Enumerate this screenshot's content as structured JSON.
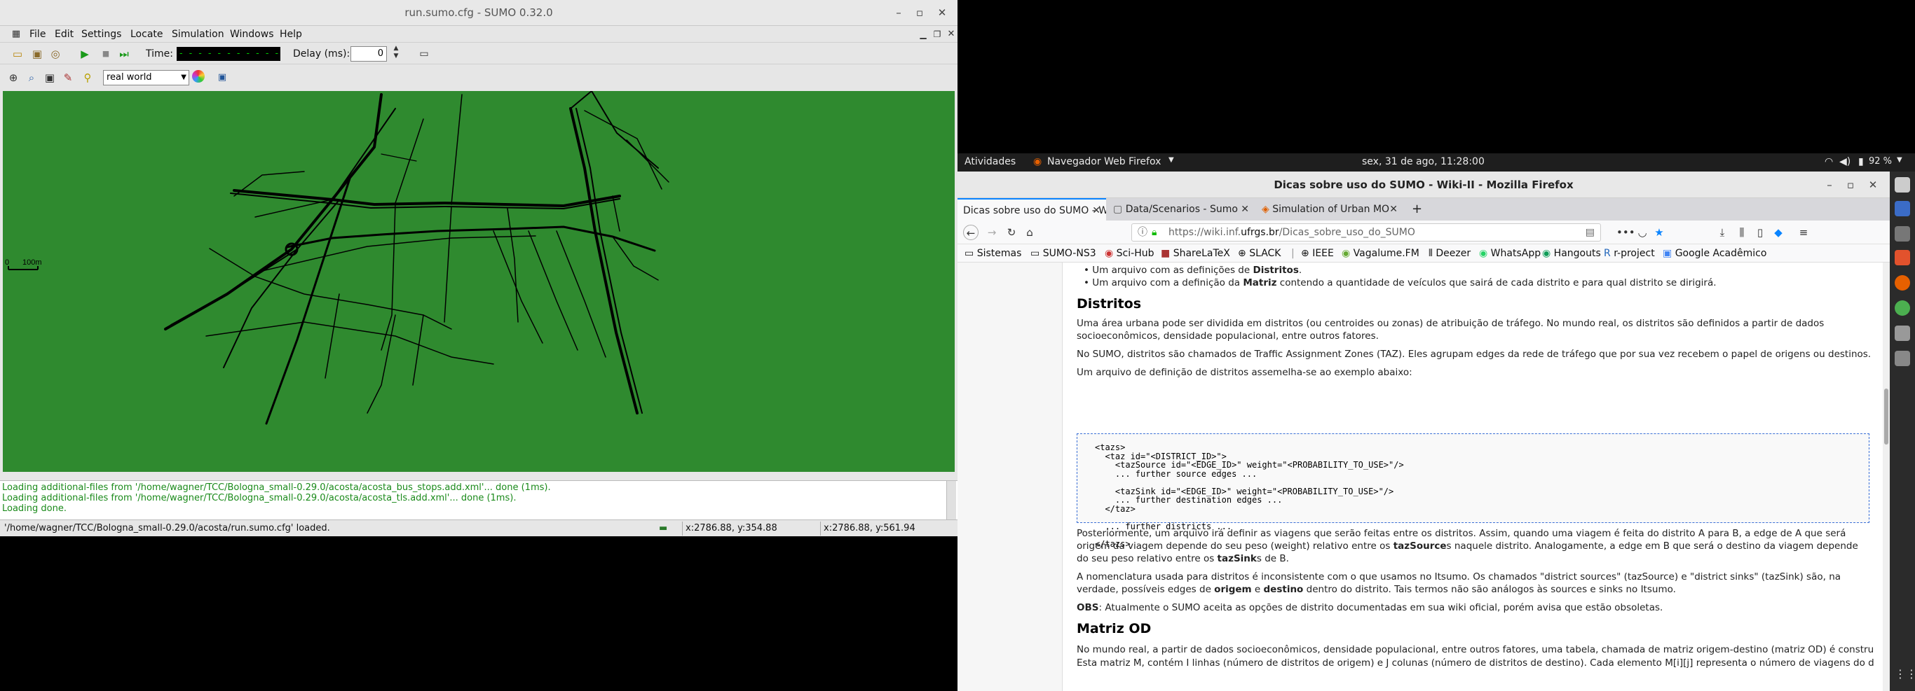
{
  "sumo": {
    "title": "run.sumo.cfg - SUMO 0.32.0",
    "menu": [
      "File",
      "Edit",
      "Settings",
      "Locate",
      "Simulation",
      "Windows",
      "Help"
    ],
    "time_label": "Time:",
    "time_value": "- - - - - - - - - - - - -",
    "delay_label": "Delay (ms):",
    "delay_value": "0",
    "scheme": "real world",
    "scale_zero": "0",
    "scale_label": "100m",
    "log": [
      "Loading additional-files from '/home/wagner/TCC/Bologna_small-0.29.0/acosta/acosta_bus_stops.add.xml'... done (1ms).",
      "Loading additional-files from '/home/wagner/TCC/Bologna_small-0.29.0/acosta/acosta_tls.add.xml'... done (1ms).",
      "Loading done."
    ],
    "status": "'/home/wagner/TCC/Bologna_small-0.29.0/acosta/run.sumo.cfg' loaded.",
    "coord1": "x:2786.88, y:354.88",
    "coord2": "x:2786.88, y:561.94"
  },
  "gnome": {
    "activities": "Atividades",
    "app": "Navegador Web Firefox",
    "clock": "sex, 31 de ago, 11:28:00",
    "battery": "92 %"
  },
  "firefox": {
    "title": "Dicas sobre uso do SUMO - Wiki-II - Mozilla Firefox",
    "tabs": [
      {
        "label": "Dicas sobre uso do SUMO - W"
      },
      {
        "label": "Data/Scenarios - Sumo"
      },
      {
        "label": "Simulation of Urban MO"
      }
    ],
    "url_host": "https://wiki.inf.",
    "url_domain": "ufrgs.br",
    "url_path": "/Dicas_sobre_uso_do_SUMO",
    "bookmarks": [
      "Sistemas",
      "SUMO-NS3",
      "Sci-Hub",
      "ShareLaTeX",
      "SLACK",
      "IEEE",
      "Vagalume.FM",
      "Deezer",
      "WhatsApp",
      "Hangouts",
      "r-project",
      "Google Acadêmico"
    ]
  },
  "wiki": {
    "bullet1_pre": "Um arquivo com as definições de ",
    "bullet1_bold": "Distritos",
    "bullet1_post": ".",
    "bullet2_pre": "Um arquivo com a definição da ",
    "bullet2_bold": "Matriz",
    "bullet2_post": " contendo a quantidade de veículos que sairá de cada distrito e para qual distrito se dirigirá.",
    "h_distritos": "Distritos",
    "p1": "Uma área urbana pode ser dividida em distritos (ou centroides ou zonas) de atribuição de tráfego. No mundo real, os distritos são definidos a partir de dados socioeconômicos, densidade populacional, entre outros fatores.",
    "p2": "No SUMO, distritos são chamados de Traffic Assignment Zones (TAZ). Eles agrupam edges da rede de tráfego que por sua vez recebem o papel de origens ou destinos.",
    "p3": "Um arquivo de definição de distritos assemelha-se ao exemplo abaixo:",
    "code": "<tazs>\n  <taz id=\"<DISTRICT_ID>\">\n    <tazSource id=\"<EDGE_ID>\" weight=\"<PROBABILITY_TO_USE>\"/>\n    ... further source edges ...\n\n    <tazSink id=\"<EDGE_ID>\" weight=\"<PROBABILITY_TO_USE>\"/>\n    ... further destination edges ...\n  </taz>\n\n  ... further districts ...\n\n</tazs>",
    "p4_a": "Posteriormente, um arquivo irá definir as viagens que serão feitas entre os distritos. Assim, quando uma viagem é feita do distrito A para B, a edge de A que será origem da viagem depende do seu peso (weight) relativo entre os ",
    "p4_b": "tazSource",
    "p4_c": "s naquele distrito. Analogamente, a edge em B que será o destino da viagem depende do seu peso relativo entre os ",
    "p4_d": "tazSink",
    "p4_e": "s de B.",
    "p5_a": "A nomenclatura usada para distritos é inconsistente com o que usamos no Itsumo. Os chamados \"district sources\" (tazSource) e \"district sinks\" (tazSink) são, na verdade, possíveis edges de ",
    "p5_b": "origem",
    "p5_c": " e ",
    "p5_d": "destino",
    "p5_e": " dentro do distrito. Tais termos não são análogos às sources e sinks no Itsumo.",
    "p6_a": "OBS",
    "p6_b": ": Atualmente o SUMO aceita as opções de distrito documentadas em sua wiki oficial, porém avisa que estão obsoletas.",
    "h_matriz": "Matriz OD",
    "p7": "No mundo real, a partir de dados socioeconômicos, densidade populacional, entre outros fatores, uma tabela, chamada de matriz origem-destino (matriz OD) é construída.",
    "p8": "Esta matriz M, contém I linhas (número de distritos de origem) e J colunas (número de distritos de destino). Cada elemento M[i][j] representa o número de viagens do distrito i"
  }
}
